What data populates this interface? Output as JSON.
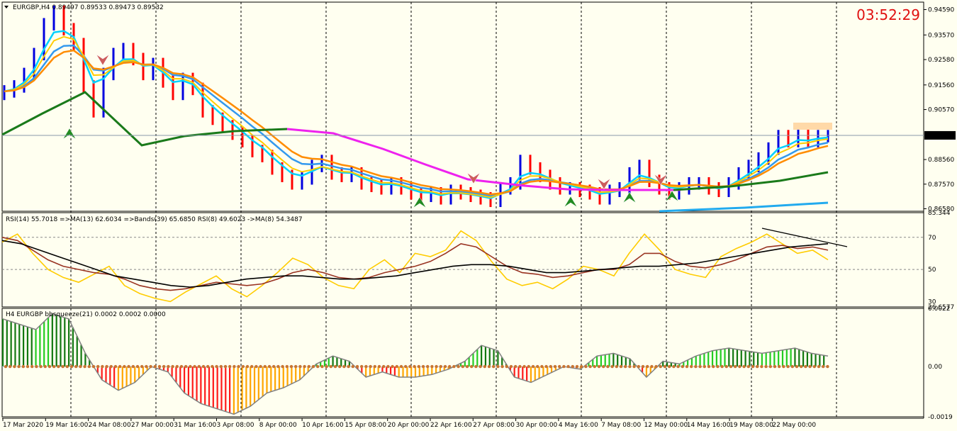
{
  "header": {
    "symbol_line": "EURGBP,H4  0.89497 0.89533 0.89473 0.89532",
    "clock": "03:52:29"
  },
  "colors": {
    "background": "#fffff0",
    "bull": "#0000e0",
    "bear": "#ff0000",
    "ma_fast": "#00d0ff",
    "ma_mid": "#3399ee",
    "ma_orange": "#ff8c00",
    "ma_yellow": "#ffcc00",
    "ma_long_green": "#1a7a1a",
    "ma_long_magenta": "#ee22ee",
    "ma_lower_cyan": "#22aaee",
    "rsi_yellow": "#ffcc00",
    "rsi_brown": "#993322",
    "rsi_black": "#000000",
    "hist_green": "#22cc22",
    "hist_dkgreen": "#117711",
    "hist_red": "#ff1a1a",
    "hist_orange": "#ffa500"
  },
  "price_panel": {
    "y_ticks": [
      "0.94590",
      "0.93570",
      "0.92580",
      "0.91560",
      "0.90570",
      "0.88560",
      "0.87570",
      "0.86580"
    ],
    "current_price": "0.89532"
  },
  "rsi_panel": {
    "label": "RSI(14) 55.7018  =>MA(13) 62.6034  =>Bands(39) 65.6850  RSI(8) 49.6023  ->MA(8) 54.3487",
    "y_ticks": [
      "85.344",
      "70",
      "50",
      "30",
      "26.6577"
    ]
  },
  "squeeze_panel": {
    "label": "H4 EURGBP bbsqueeze(21) 0.0002 0.0002 0.0000",
    "y_ticks": [
      "0.0022",
      "0.00",
      "-0.0019"
    ]
  },
  "x_axis": {
    "labels": [
      "17 Mar 2020",
      "19 Mar 16:00",
      "24 Mar 08:00",
      "27 Mar 00:00",
      "31 Mar 16:00",
      "3 Apr 08:00",
      "8 Apr 00:00",
      "10 Apr 16:00",
      "15 Apr 08:00",
      "20 Apr 00:00",
      "22 Apr 16:00",
      "27 Apr 08:00",
      "30 Apr 00:00",
      "4 May 16:00",
      "7 May 08:00",
      "12 May 00:00",
      "14 May 16:00",
      "19 May 08:00",
      "22 May 00:00"
    ]
  },
  "chart_data": [
    {
      "type": "bar",
      "name": "EURGBP H4",
      "ylim": [
        0.8648,
        0.9489
      ],
      "series": [
        {
          "name": "close",
          "values": [
            0.913,
            0.915,
            0.92,
            0.928,
            0.94,
            0.945,
            0.938,
            0.932,
            0.915,
            0.905,
            0.92,
            0.928,
            0.93,
            0.926,
            0.92,
            0.924,
            0.917,
            0.912,
            0.918,
            0.914,
            0.905,
            0.902,
            0.899,
            0.896,
            0.893,
            0.889,
            0.887,
            0.882,
            0.879,
            0.876,
            0.878,
            0.883,
            0.885,
            0.88,
            0.879,
            0.88,
            0.876,
            0.875,
            0.874,
            0.876,
            0.874,
            0.872,
            0.871,
            0.872,
            0.87,
            0.873,
            0.872,
            0.871,
            0.87,
            0.869,
            0.874,
            0.876,
            0.885,
            0.882,
            0.879,
            0.876,
            0.874,
            0.874,
            0.873,
            0.872,
            0.87,
            0.873,
            0.874,
            0.88,
            0.883,
            0.877,
            0.874,
            0.872,
            0.874,
            0.876,
            0.876,
            0.874,
            0.873,
            0.876,
            0.88,
            0.883,
            0.886,
            0.89,
            0.895,
            0.893,
            0.896,
            0.893,
            0.895,
            0.895
          ]
        }
      ]
    },
    {
      "type": "line",
      "name": "RSI",
      "ylim": [
        26.6577,
        85.344
      ],
      "series": [
        {
          "values": [
            67,
            72,
            60,
            50,
            45,
            42,
            47,
            52,
            40,
            35,
            32,
            30,
            36,
            41,
            46,
            38,
            33,
            40,
            48,
            57,
            53,
            45,
            40,
            38,
            50,
            56,
            48,
            60,
            58,
            62,
            74,
            68,
            55,
            44,
            40,
            42,
            38,
            44,
            52,
            50,
            46,
            60,
            72,
            62,
            50,
            47,
            45,
            58,
            63,
            67,
            72,
            66,
            60,
            62,
            56
          ]
        },
        {
          "values": [
            70,
            68,
            62,
            56,
            52,
            50,
            48,
            47,
            44,
            40,
            38,
            37,
            38,
            40,
            42,
            41,
            40,
            41,
            44,
            48,
            50,
            48,
            45,
            44,
            45,
            48,
            50,
            52,
            55,
            60,
            66,
            64,
            58,
            52,
            48,
            47,
            45,
            46,
            48,
            50,
            50,
            53,
            60,
            60,
            55,
            52,
            51,
            53,
            56,
            60,
            64,
            65,
            63,
            64,
            62
          ]
        },
        {
          "values": [
            68,
            66,
            62,
            58,
            54,
            50,
            46,
            44,
            42,
            40,
            39,
            40,
            42,
            44,
            45,
            46,
            46,
            45,
            44,
            44,
            45,
            46,
            48,
            50,
            52,
            53,
            53,
            52,
            50,
            48,
            48,
            49,
            50,
            51,
            52,
            52,
            53,
            54,
            56,
            58,
            60,
            62,
            64,
            65,
            66
          ]
        }
      ]
    },
    {
      "type": "bar",
      "name": "bbsqueeze(21)",
      "ylim": [
        -0.0019,
        0.0022
      ],
      "values": [
        0.0018,
        0.0016,
        0.0014,
        0.002,
        0.0018,
        0.0005,
        -0.0005,
        -0.0009,
        -0.0006,
        0.0,
        -0.0002,
        -0.001,
        -0.0014,
        -0.0016,
        -0.0018,
        -0.0015,
        -0.001,
        -0.0008,
        -0.0005,
        0.0001,
        0.0004,
        0.0002,
        -0.0004,
        -0.0002,
        -0.0004,
        -0.0004,
        -0.0003,
        -0.0001,
        0.0002,
        0.0008,
        0.0006,
        -0.0004,
        -0.0006,
        -0.0003,
        0.0,
        -0.0001,
        0.0004,
        0.0005,
        0.0003,
        -0.0004,
        0.0002,
        0.0001,
        0.0004,
        0.0006,
        0.0007,
        0.0006,
        0.0005,
        0.0006,
        0.0007,
        0.0005,
        0.0004
      ]
    }
  ]
}
